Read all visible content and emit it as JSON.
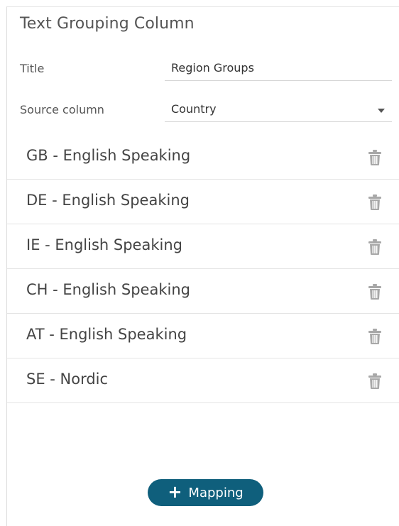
{
  "panel": {
    "title": "Text Grouping Column"
  },
  "fields": {
    "title": {
      "label": "Title",
      "value": "Region Groups"
    },
    "source_column": {
      "label": "Source column",
      "value": "Country"
    }
  },
  "mappings": [
    {
      "label": "GB - English Speaking",
      "icon": "trash-icon"
    },
    {
      "label": "DE - English Speaking",
      "icon": "trash-icon"
    },
    {
      "label": "IE - English Speaking",
      "icon": "trash-icon"
    },
    {
      "label": "CH - English Speaking",
      "icon": "trash-icon"
    },
    {
      "label": "AT - English Speaking",
      "icon": "trash-icon"
    },
    {
      "label": "SE - Nordic",
      "icon": "trash-icon"
    }
  ],
  "add_button": {
    "icon": "plus-icon",
    "icon_glyph": "+",
    "label": "Mapping"
  },
  "colors": {
    "accent": "#0f5f7c",
    "icon_gray": "#a8a8a8"
  }
}
